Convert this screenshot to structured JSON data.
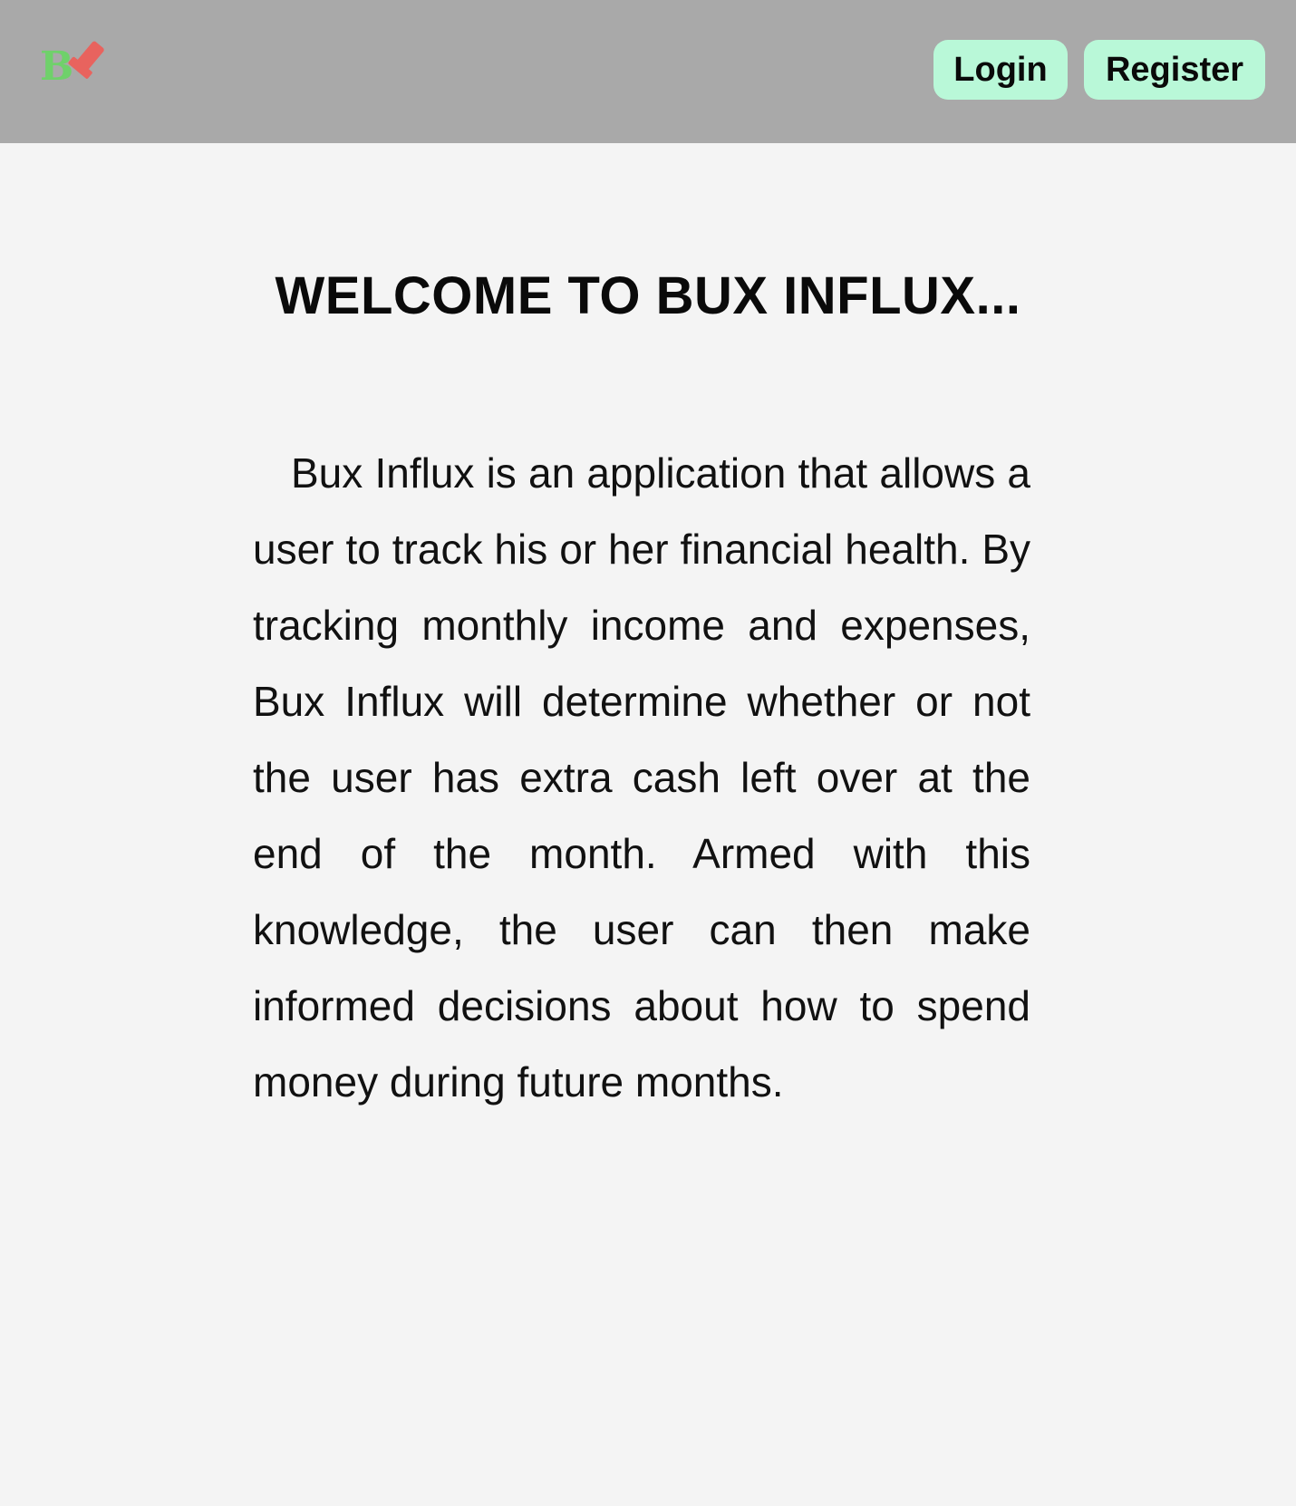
{
  "header": {
    "logo": {
      "text": "B",
      "icon": "bux-influx-logo",
      "colors": {
        "letter": "#6fd16a",
        "mark": "#e8635e"
      }
    },
    "login_label": "Login",
    "register_label": "Register"
  },
  "main": {
    "title": "WELCOME TO BUX INFLUX...",
    "description": "Bux Influx is an application that allows a user to track his or her financial health. By tracking monthly income and expenses, Bux Influx will determine whether or not the user has extra cash left over at the end of the month. Armed with this knowledge, the user can then make informed decisions about how to spend money during future months."
  },
  "colors": {
    "navbar": "#a9a9a9",
    "button": "#b9f8d8",
    "background": "#f4f4f4"
  }
}
